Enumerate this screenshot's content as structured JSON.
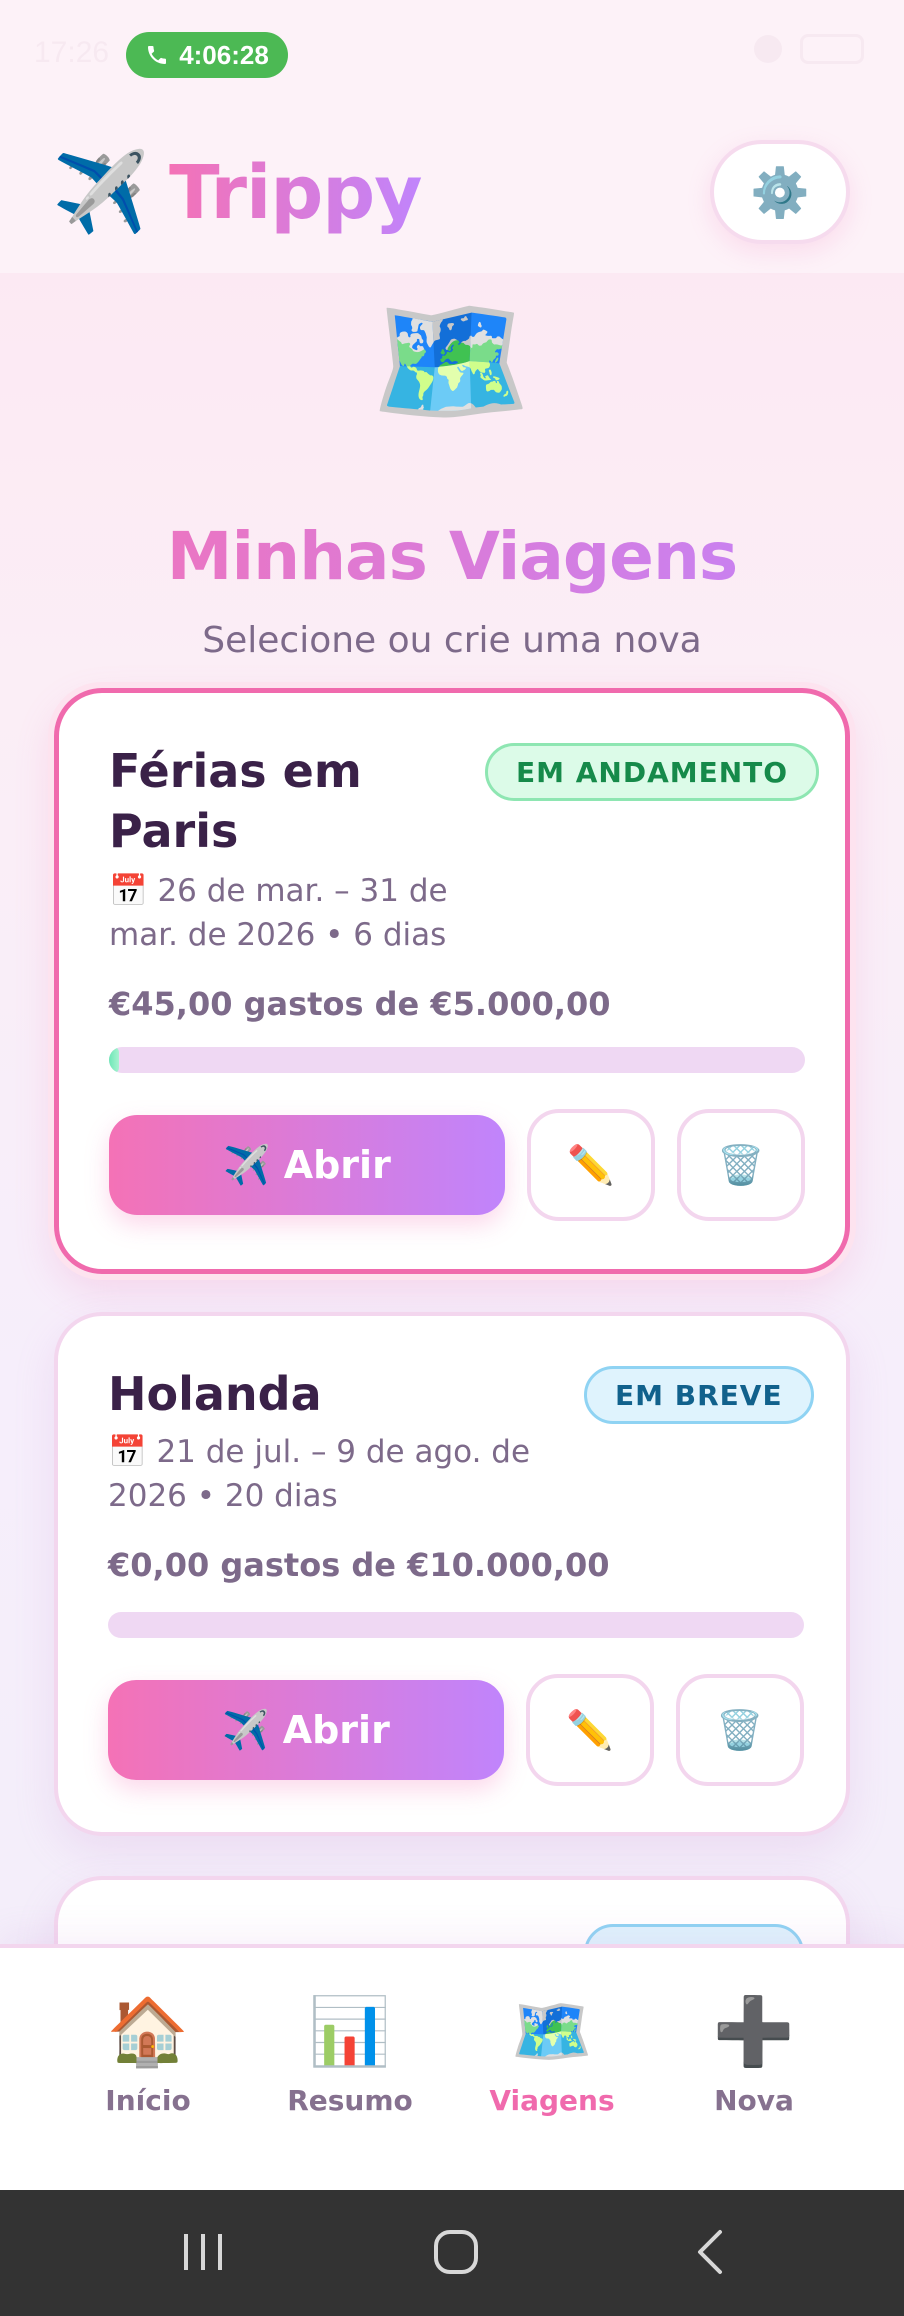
{
  "status_bar": {
    "time": "17:26",
    "call_timer": "4:06:28"
  },
  "header": {
    "logo_emoji": "✈️",
    "app_name": "Trippy",
    "settings_emoji": "⚙️"
  },
  "hero": {
    "emoji": "🗺️",
    "title": "Minhas Viagens",
    "subtitle": "Selecione ou crie uma nova"
  },
  "trips": [
    {
      "name": "Férias em Paris",
      "name_line1": "Férias em",
      "name_line2": "Paris",
      "status": "EM ANDAMENTO",
      "dates_line1": "📅 26 de mar. – 31 de",
      "dates_line2": "mar. de 2026 • 6 dias",
      "spent_text": "€45,00 gastos de €5.000,00",
      "progress_fraction": 0.009,
      "open_label": "✈️ Abrir",
      "edit_emoji": "✏️",
      "delete_emoji": "🗑️"
    },
    {
      "name": "Holanda",
      "status": "EM BREVE",
      "dates_line1": "📅 21 de jul. – 9 de ago. de",
      "dates_line2": "2026 • 20 dias",
      "spent_text": "€0,00 gastos de €10.000,00",
      "progress_fraction": 0,
      "open_label": "✈️ Abrir",
      "edit_emoji": "✏️",
      "delete_emoji": "🗑️"
    }
  ],
  "bottom_nav": [
    {
      "emoji": "🏠",
      "label": "Início"
    },
    {
      "emoji": "📊",
      "label": "Resumo"
    },
    {
      "emoji": "🗺️",
      "label": "Viagens",
      "active": true
    },
    {
      "emoji": "➕",
      "label": "Nova"
    }
  ],
  "colors": {
    "accent_pink": "#f472b6",
    "accent_purple": "#c084fc",
    "ongoing_green": "#168a4a",
    "soon_blue": "#11618c"
  }
}
